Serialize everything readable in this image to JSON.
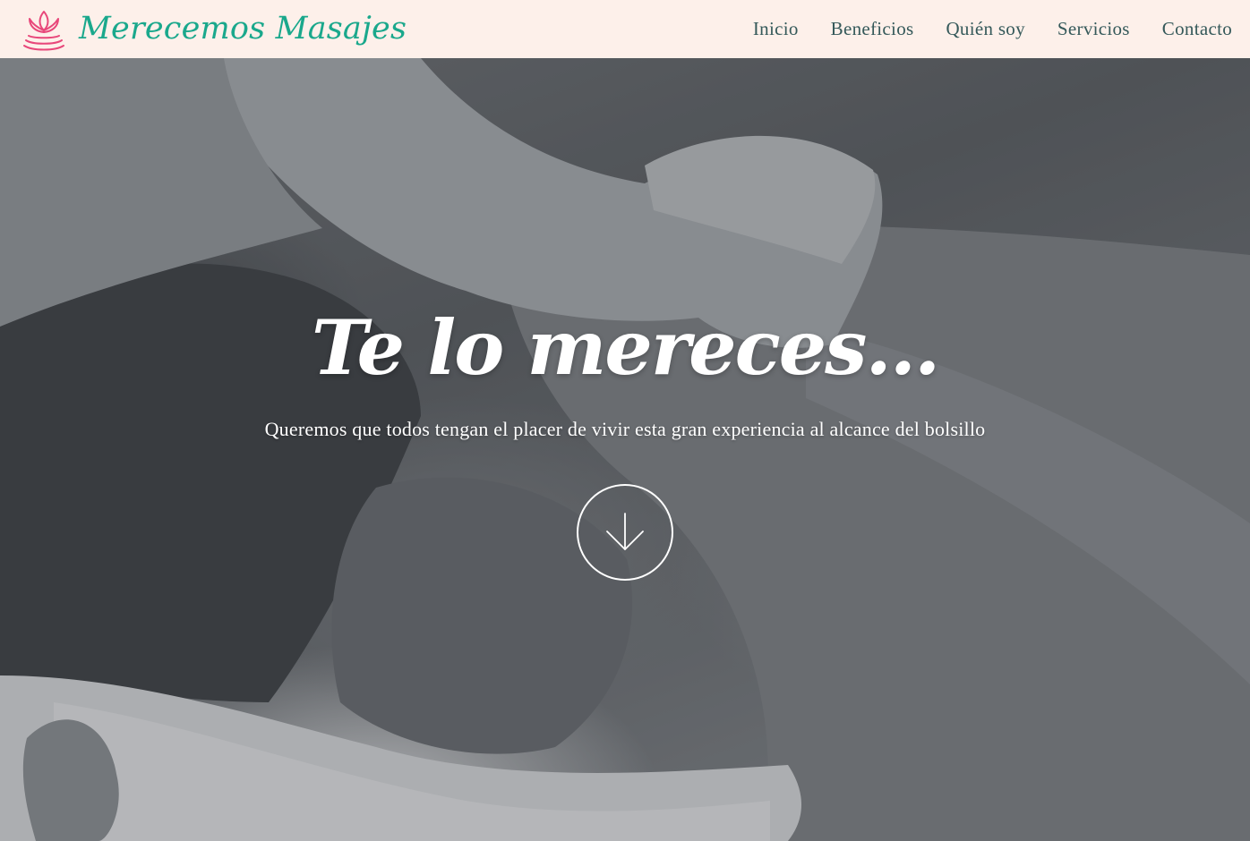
{
  "brand": {
    "name": "Merecemos Masajes",
    "logo_icon": "lotus-candle-icon",
    "color": "#1aa88c",
    "logo_color": "#e8477a"
  },
  "nav": {
    "items": [
      {
        "label": "Inicio"
      },
      {
        "label": "Beneficios"
      },
      {
        "label": "Quién soy"
      },
      {
        "label": "Servicios"
      },
      {
        "label": "Contacto"
      }
    ]
  },
  "hero": {
    "title": "Te lo mereces...",
    "subtitle": "Queremos que todos tengan el placer de vivir esta gran experiencia al alcance del bolsillo",
    "scroll_icon": "arrow-down-icon"
  },
  "colors": {
    "navbar_bg": "#fdf0ea",
    "nav_text": "#35595a",
    "hero_text": "#ffffff"
  }
}
